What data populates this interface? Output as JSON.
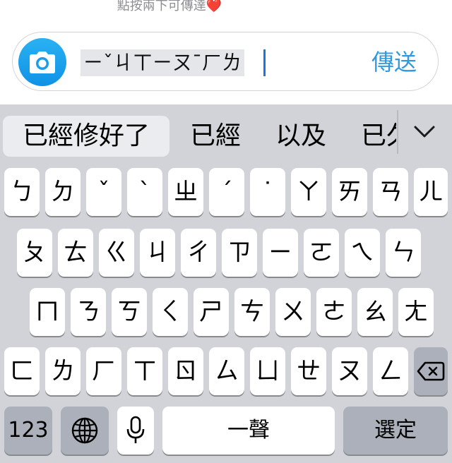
{
  "hint_text": "點按兩下可傳達",
  "heart": "❤️",
  "input": {
    "composing": "ㄧˇㄐㄒㄧㄡ¯ㄏㄌ"
  },
  "send_label": "傳送",
  "candidates": [
    "已經修好了",
    "已經",
    "以及",
    "已久"
  ],
  "keys": {
    "row1": [
      "ㄅ",
      "ㄉ",
      "ˇ",
      "ˋ",
      "ㄓ",
      "ˊ",
      "˙",
      "ㄚ",
      "ㄞ",
      "ㄢ",
      "ㄦ"
    ],
    "row2": [
      "ㄆ",
      "ㄊ",
      "ㄍ",
      "ㄐ",
      "ㄔ",
      "ㄗ",
      "ㄧ",
      "ㄛ",
      "ㄟ",
      "ㄣ"
    ],
    "row3": [
      "ㄇ",
      "ㄋ",
      "ㄎ",
      "ㄑ",
      "ㄕ",
      "ㄘ",
      "ㄨ",
      "ㄜ",
      "ㄠ",
      "ㄤ"
    ],
    "row4": [
      "ㄈ",
      "ㄌ",
      "ㄏ",
      "ㄒ",
      "ㄖ",
      "ㄙ",
      "ㄩ",
      "ㄝ",
      "ㄡ",
      "ㄥ"
    ]
  },
  "bottom": {
    "numbers": "123",
    "space": "一聲",
    "confirm": "選定"
  },
  "colors": {
    "accent": "#2f9ae0",
    "camera": "#1a9deb",
    "keyboard_bg": "#d1d3d9",
    "caret": "#1b73e8"
  },
  "icons": {
    "camera": "camera-icon",
    "expand": "chevron-down-icon",
    "backspace": "backspace-icon",
    "globe": "globe-icon",
    "mic": "microphone-icon"
  }
}
